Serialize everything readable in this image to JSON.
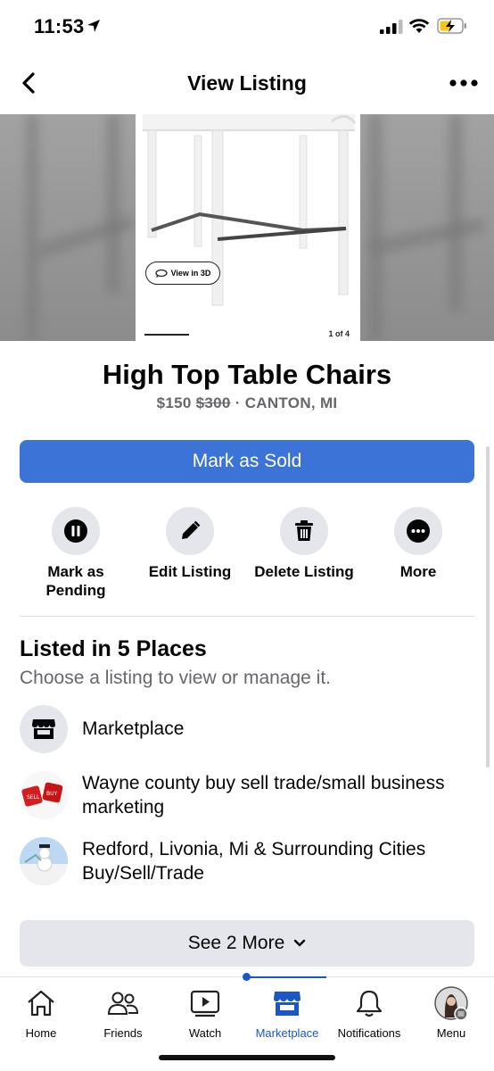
{
  "status_bar": {
    "time": "11:53",
    "icons": [
      "location-arrow-icon",
      "signal-icon",
      "wifi-icon",
      "battery-charging-icon"
    ]
  },
  "header": {
    "title": "View Listing",
    "back_icon": "chevron-left-icon",
    "more_icon": "more-dots-icon"
  },
  "gallery": {
    "view_3d_label": "View in 3D",
    "counter": "1 of 4"
  },
  "listing": {
    "title": "High Top Table Chairs",
    "price": "$150",
    "original_price": "$300",
    "separator": "·",
    "location": "CANTON, MI"
  },
  "primary_action": {
    "label": "Mark as Sold",
    "color": "#3b74d6"
  },
  "actions": [
    {
      "label": "Mark as Pending",
      "icon": "pause-icon"
    },
    {
      "label": "Edit Listing",
      "icon": "pencil-icon"
    },
    {
      "label": "Delete Listing",
      "icon": "trash-icon"
    },
    {
      "label": "More",
      "icon": "more-dots-icon"
    }
  ],
  "places": {
    "title": "Listed in 5 Places",
    "subtitle": "Choose a listing to view or manage it.",
    "items": [
      {
        "name": "Marketplace",
        "icon": "storefront-icon"
      },
      {
        "name": "Wayne county buy sell trade/small business marketing",
        "icon": "group-avatar"
      },
      {
        "name": "Redford, Livonia, Mi & Surrounding Cities Buy/Sell/Trade",
        "icon": "group-avatar"
      }
    ],
    "see_more_label": "See 2 More"
  },
  "tab_bar": {
    "tabs": [
      {
        "label": "Home",
        "icon": "home-icon"
      },
      {
        "label": "Friends",
        "icon": "friends-icon"
      },
      {
        "label": "Watch",
        "icon": "watch-icon"
      },
      {
        "label": "Marketplace",
        "icon": "marketplace-icon",
        "active": true
      },
      {
        "label": "Notifications",
        "icon": "bell-icon"
      },
      {
        "label": "Menu",
        "icon": "profile-avatar"
      }
    ],
    "active_color": "#1a56c4"
  }
}
